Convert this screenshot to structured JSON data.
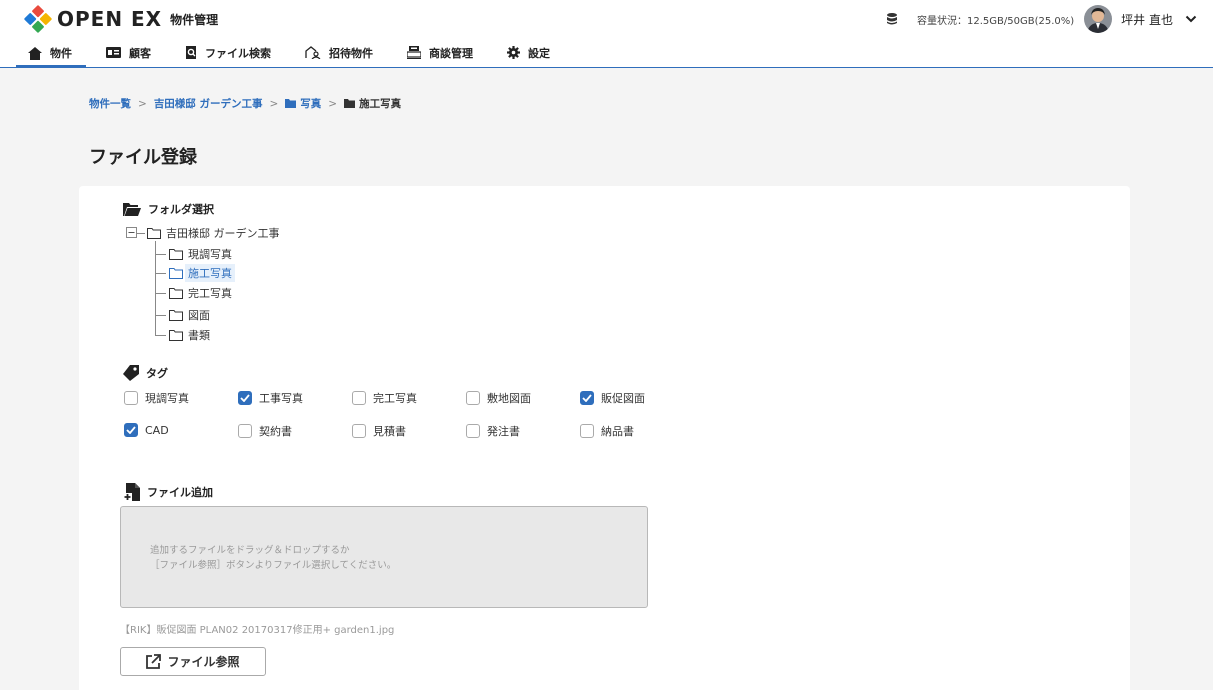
{
  "header": {
    "app_name": "OPEN EX",
    "app_sub": "物件管理",
    "capacity": "容量状況：12.5GB/50GB(25.0%)",
    "user_name": "坪井 直也"
  },
  "nav": [
    {
      "label": "物件",
      "icon": "home-icon",
      "active": true
    },
    {
      "label": "顧客",
      "icon": "id-card-icon"
    },
    {
      "label": "ファイル検索",
      "icon": "file-search-icon"
    },
    {
      "label": "招待物件",
      "icon": "invite-icon"
    },
    {
      "label": "商談管理",
      "icon": "register-icon"
    },
    {
      "label": "設定",
      "icon": "gear-icon"
    }
  ],
  "breadcrumb": {
    "items": [
      "物件一覧",
      "吉田様邸 ガーデン工事",
      "写真",
      "施工写真"
    ]
  },
  "page_title": "ファイル登録",
  "folder_section": {
    "title": "フォルダ選択",
    "root": "吉田様邸 ガーデン工事",
    "children": [
      "現調写真",
      "施工写真",
      "完工写真",
      "図面",
      "書類"
    ],
    "selected": "施工写真"
  },
  "tag_section": {
    "title": "タグ",
    "tags": [
      {
        "label": "現調写真",
        "checked": false
      },
      {
        "label": "工事写真",
        "checked": true
      },
      {
        "label": "完工写真",
        "checked": false
      },
      {
        "label": "敷地図面",
        "checked": false
      },
      {
        "label": "販促図面",
        "checked": true
      },
      {
        "label": "CAD",
        "checked": true
      },
      {
        "label": "契約書",
        "checked": false
      },
      {
        "label": "見積書",
        "checked": false
      },
      {
        "label": "発注書",
        "checked": false
      },
      {
        "label": "納品書",
        "checked": false
      }
    ]
  },
  "file_section": {
    "title": "ファイル追加",
    "drop_line1": "追加するファイルをドラッグ＆ドロップするか",
    "drop_line2": "［ファイル参照］ボタンよりファイル選択してください。",
    "file_name": "【RIK】販促図面 PLAN02 20170317修正用+ garden1.jpg",
    "browse_label": "ファイル参照"
  },
  "colors": {
    "accent": "#2f6ebc",
    "background": "#f4f4f4"
  }
}
